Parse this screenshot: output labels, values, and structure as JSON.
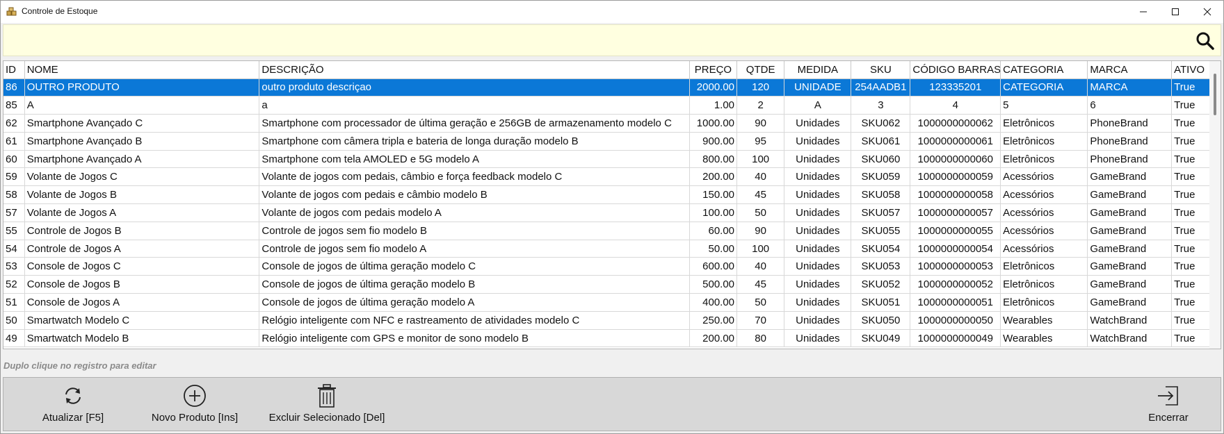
{
  "window": {
    "title": "Controle de Estoque"
  },
  "search": {
    "value": "",
    "placeholder": ""
  },
  "columns": [
    "ID",
    "NOME",
    "DESCRIÇÃO",
    "PREÇO",
    "QTDE",
    "MEDIDA",
    "SKU",
    "CÓDIGO BARRAS",
    "CATEGORIA",
    "MARCA",
    "ATIVO"
  ],
  "rows": [
    [
      "86",
      "OUTRO PRODUTO",
      "outro produto descriçao",
      "2000.00",
      "120",
      "UNIDADE",
      "254AADB1",
      "123335201",
      "CATEGORIA",
      "MARCA",
      "True"
    ],
    [
      "85",
      "A",
      "a",
      "1.00",
      "2",
      "A",
      "3",
      "4",
      "5",
      "6",
      "True"
    ],
    [
      "62",
      "Smartphone Avançado C",
      "Smartphone com processador de última geração e 256GB de armazenamento modelo C",
      "1000.00",
      "90",
      "Unidades",
      "SKU062",
      "1000000000062",
      "Eletrônicos",
      "PhoneBrand",
      "True"
    ],
    [
      "61",
      "Smartphone Avançado B",
      "Smartphone com câmera tripla e bateria de longa duração modelo B",
      "900.00",
      "95",
      "Unidades",
      "SKU061",
      "1000000000061",
      "Eletrônicos",
      "PhoneBrand",
      "True"
    ],
    [
      "60",
      "Smartphone Avançado A",
      "Smartphone com tela AMOLED e 5G modelo A",
      "800.00",
      "100",
      "Unidades",
      "SKU060",
      "1000000000060",
      "Eletrônicos",
      "PhoneBrand",
      "True"
    ],
    [
      "59",
      "Volante de Jogos C",
      "Volante de jogos com pedais, câmbio e força feedback modelo C",
      "200.00",
      "40",
      "Unidades",
      "SKU059",
      "1000000000059",
      "Acessórios",
      "GameBrand",
      "True"
    ],
    [
      "58",
      "Volante de Jogos B",
      "Volante de jogos com pedais e câmbio modelo B",
      "150.00",
      "45",
      "Unidades",
      "SKU058",
      "1000000000058",
      "Acessórios",
      "GameBrand",
      "True"
    ],
    [
      "57",
      "Volante de Jogos A",
      "Volante de jogos com pedais modelo A",
      "100.00",
      "50",
      "Unidades",
      "SKU057",
      "1000000000057",
      "Acessórios",
      "GameBrand",
      "True"
    ],
    [
      "55",
      "Controle de Jogos B",
      "Controle de jogos sem fio modelo B",
      "60.00",
      "90",
      "Unidades",
      "SKU055",
      "1000000000055",
      "Acessórios",
      "GameBrand",
      "True"
    ],
    [
      "54",
      "Controle de Jogos A",
      "Controle de jogos sem fio modelo A",
      "50.00",
      "100",
      "Unidades",
      "SKU054",
      "1000000000054",
      "Acessórios",
      "GameBrand",
      "True"
    ],
    [
      "53",
      "Console de Jogos C",
      "Console de jogos de última geração modelo C",
      "600.00",
      "40",
      "Unidades",
      "SKU053",
      "1000000000053",
      "Eletrônicos",
      "GameBrand",
      "True"
    ],
    [
      "52",
      "Console de Jogos B",
      "Console de jogos de última geração modelo B",
      "500.00",
      "45",
      "Unidades",
      "SKU052",
      "1000000000052",
      "Eletrônicos",
      "GameBrand",
      "True"
    ],
    [
      "51",
      "Console de Jogos A",
      "Console de jogos de última geração modelo A",
      "400.00",
      "50",
      "Unidades",
      "SKU051",
      "1000000000051",
      "Eletrônicos",
      "GameBrand",
      "True"
    ],
    [
      "50",
      "Smartwatch Modelo C",
      "Relógio inteligente com NFC e rastreamento de atividades modelo C",
      "250.00",
      "70",
      "Unidades",
      "SKU050",
      "1000000000050",
      "Wearables",
      "WatchBrand",
      "True"
    ],
    [
      "49",
      "Smartwatch Modelo B",
      "Relógio inteligente com GPS e monitor de sono modelo B",
      "200.00",
      "80",
      "Unidades",
      "SKU049",
      "1000000000049",
      "Wearables",
      "WatchBrand",
      "True"
    ]
  ],
  "selected_row": 0,
  "hint": "Duplo clique no registro para editar",
  "toolbar": {
    "refresh_label": "Atualizar [F5]",
    "new_label": "Novo Produto [Ins]",
    "delete_label": "Excluir Selecionado [Del]",
    "exit_label": "Encerrar"
  },
  "colors": {
    "selection": "#0b78d7",
    "search_bg": "#ffffe0",
    "toolbar_bg": "#d8d8d8"
  }
}
